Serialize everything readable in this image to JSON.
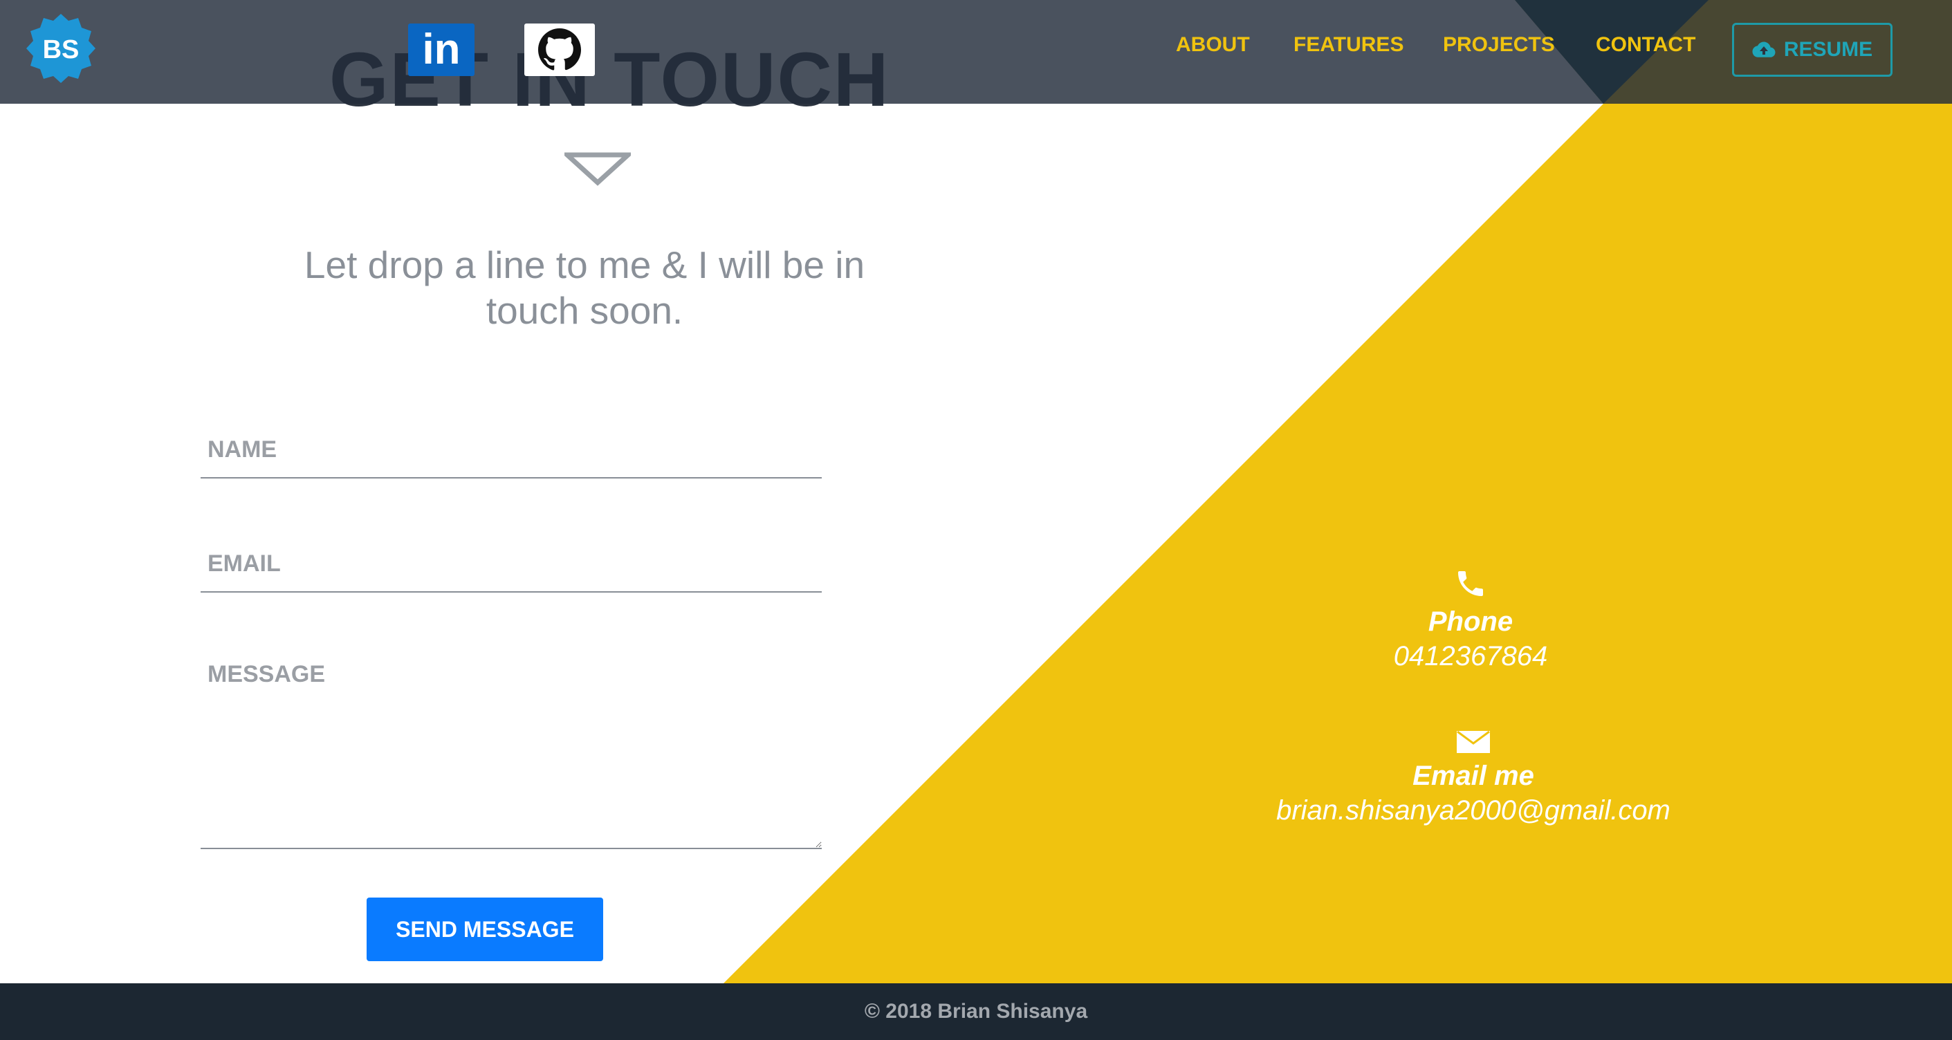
{
  "brand": {
    "logo_text": "BS"
  },
  "social": {
    "linkedin_label": "in"
  },
  "nav": {
    "items": [
      "ABOUT",
      "FEATURES",
      "PROJECTS",
      "CONTACT"
    ],
    "resume_label": "RESUME"
  },
  "section": {
    "title": "GET IN TOUCH",
    "tagline": "Let drop a line to me & I will be in touch soon."
  },
  "form": {
    "name_placeholder": "NAME",
    "email_placeholder": "EMAIL",
    "message_placeholder": "MESSAGE",
    "submit_label": "SEND MESSAGE"
  },
  "contact": {
    "phone_label": "Phone",
    "phone_value": "0412367864",
    "email_label": "Email me",
    "email_value": "brian.shisanya2000@gmail.com"
  },
  "footer": {
    "text": "© 2018 Brian Shisanya"
  },
  "colors": {
    "accent_yellow": "#f0c30f",
    "button_blue": "#0a7bff",
    "navbar": "#222c3a",
    "footer": "#1c2732",
    "resume_teal": "#1e9aa8"
  },
  "icons": [
    "logo-badge-icon",
    "linkedin-icon",
    "github-icon",
    "cloud-upload-icon",
    "triangle-down-icon",
    "phone-icon",
    "mail-icon"
  ]
}
